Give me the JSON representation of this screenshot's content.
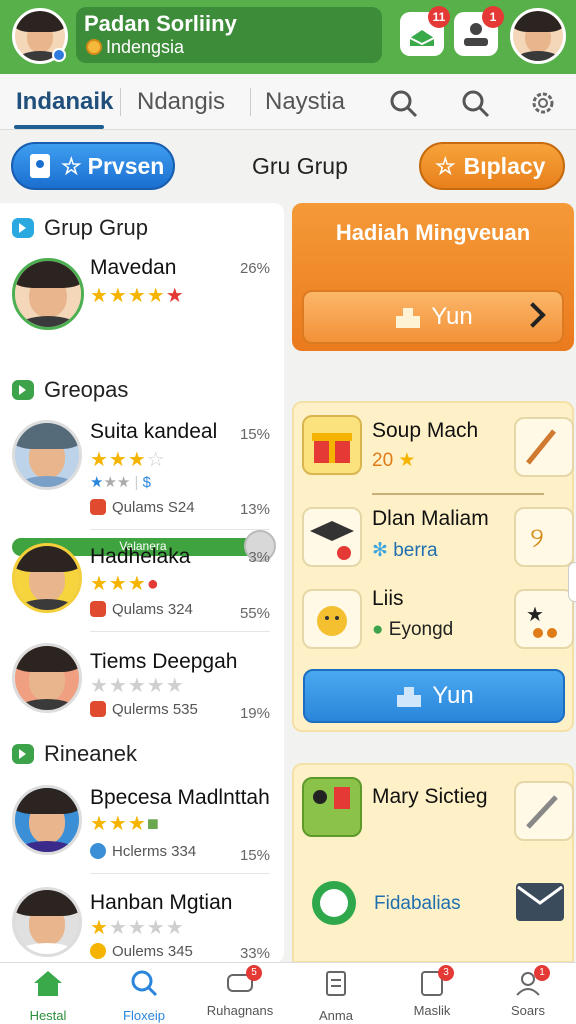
{
  "header": {
    "title": "Padan Sorliiny",
    "subtitle": "Indengsia",
    "notif1_count": "11",
    "notif2_count": "1"
  },
  "tabs": [
    {
      "label": "Indanaik",
      "active": true
    },
    {
      "label": "Ndangis",
      "active": false
    },
    {
      "label": "Naystia",
      "active": false
    }
  ],
  "actions": {
    "left_button": "Prvsen",
    "center_title": "Gru Grup",
    "right_button": "Bıplacy"
  },
  "left_list": {
    "sections": [
      {
        "title": "Grup Grup"
      },
      {
        "title": "Greopas"
      },
      {
        "title": "Rineanek"
      }
    ],
    "featured": {
      "name": "Mavedan",
      "pct": "26%",
      "stars": 4,
      "progress_label": "Valanera",
      "progress": 0.92
    },
    "rows": [
      {
        "name": "Suita kandeal",
        "pct": "15%",
        "stars": 3,
        "sub_pct": "",
        "sub": ""
      },
      {
        "name": "",
        "pct": "",
        "stars": 0,
        "sub": "Qulams S24",
        "sub_pct": "13%"
      },
      {
        "name": "Hadhelaka",
        "pct": "3%",
        "stars": 3,
        "sub": "Qulams 324",
        "sub_pct": "55%"
      },
      {
        "name": "Tiems Deepgah",
        "pct": "",
        "stars": 0,
        "sub": "Qulerms 535",
        "sub_pct": "19%"
      },
      {
        "name": "Bpecesa Madlnttah",
        "pct": "",
        "stars": 3,
        "sub": "Hclerms 334",
        "sub_pct": "15%"
      },
      {
        "name": "Hanban Mgtian",
        "pct": "",
        "stars": 1,
        "sub": "Oulems 345",
        "sub_pct": "33%"
      }
    ]
  },
  "right": {
    "weekly": {
      "title": "Hadiah Mingveuan",
      "button": "Yun"
    },
    "items": [
      {
        "name": "Soup Mach",
        "sub": "20",
        "sub_color": "#e07b1a"
      },
      {
        "name": "Dlan Maliam",
        "sub": "berra",
        "sub_color": "#1f6fb0"
      },
      {
        "name": "Liis",
        "sub": "Eyongd",
        "sub_color": "#222222"
      }
    ],
    "blue_button": "Yun",
    "lower": {
      "name": "Mary Sictieg",
      "link": "Fidabalias"
    }
  },
  "bottom_nav": [
    {
      "label": "Hestal",
      "active": true,
      "badge": ""
    },
    {
      "label": "Floxeip",
      "active": false,
      "badge": ""
    },
    {
      "label": "Ruhagnans",
      "active": false,
      "badge": "5"
    },
    {
      "label": "Anma",
      "active": false,
      "badge": ""
    },
    {
      "label": "Maslik",
      "active": false,
      "badge": "3"
    },
    {
      "label": "Soars",
      "active": false,
      "badge": "1"
    }
  ],
  "colors": {
    "brand_green": "#57b04a",
    "accent_blue": "#2a86db",
    "accent_orange": "#ea7a1d"
  }
}
